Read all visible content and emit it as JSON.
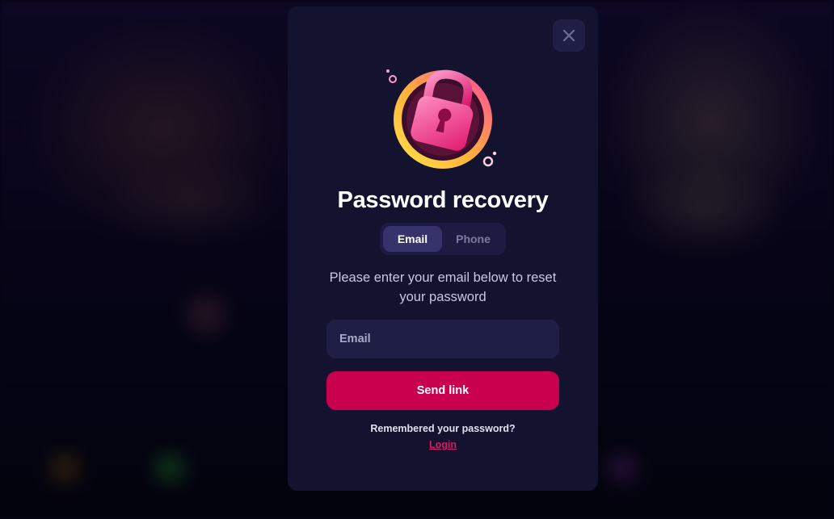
{
  "modal": {
    "title": "Password recovery",
    "tabs": [
      {
        "label": "Email",
        "active": true
      },
      {
        "label": "Phone",
        "active": false
      }
    ],
    "description": "Please enter your email below to reset your password",
    "email_input": {
      "placeholder": "Email",
      "value": ""
    },
    "send_button_label": "Send link",
    "remember_text": "Remembered your password?",
    "login_link_label": "Login",
    "close_icon": "close-icon",
    "illustration_icon": "padlock-icon"
  },
  "colors": {
    "modal_bg": "#13122f",
    "accent": "#c8004e",
    "link": "#d81a68",
    "tab_active_bg": "#35336a",
    "input_bg": "#1f1e45"
  }
}
